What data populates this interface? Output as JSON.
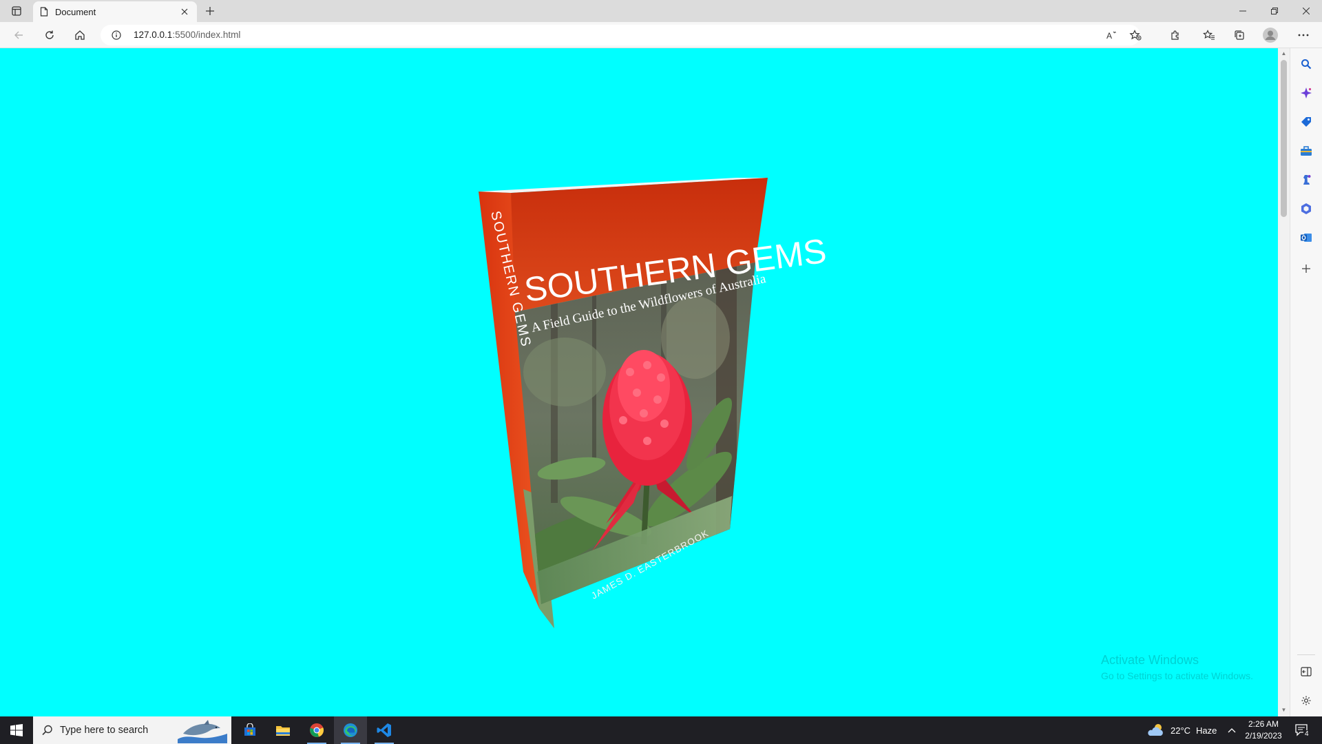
{
  "browser": {
    "tab": {
      "title": "Document"
    },
    "address": {
      "host": "127.0.0.1",
      "path": ":5500/index.html"
    }
  },
  "book": {
    "title": "SOUTHERN GEMS",
    "subtitle": "A Field Guide to the Wildflowers of Australia",
    "author": "JAMES D. EASTERBROOK",
    "spine_title": "SOUTHERN GEMS",
    "colors": {
      "band": "#d23a12",
      "spine": "#e24818",
      "page_bg": "#00ffff",
      "footer": "#6f9a64"
    }
  },
  "watermark": {
    "line1": "Activate Windows",
    "line2": "Go to Settings to activate Windows."
  },
  "taskbar": {
    "search_placeholder": "Type here to search",
    "weather_temp": "22°C",
    "weather_desc": "Haze",
    "time": "2:26 AM",
    "date": "2/19/2023",
    "notification_count": "4"
  }
}
